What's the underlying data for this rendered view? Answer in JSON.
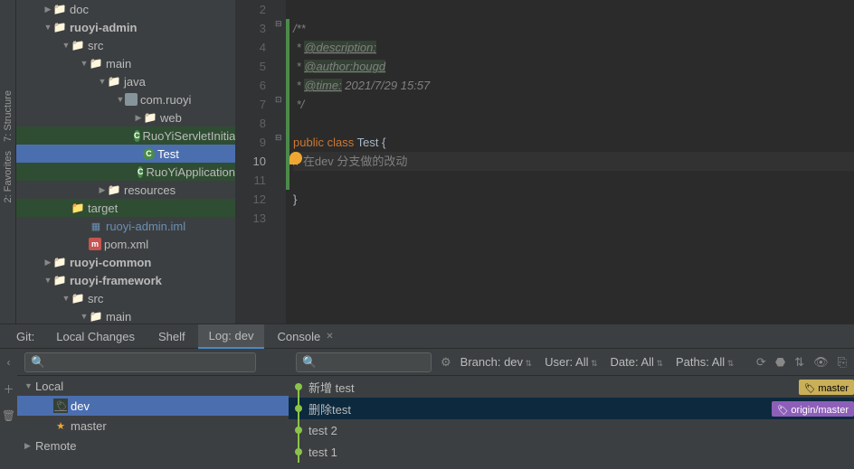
{
  "leftbar": {
    "structure": "7: Structure",
    "favorites": "2: Favorites"
  },
  "tree": [
    {
      "ind": 30,
      "arw": "closed",
      "ico": "folder",
      "txt": "doc"
    },
    {
      "ind": 30,
      "arw": "open",
      "ico": "folder",
      "txt": "ruoyi-admin",
      "bold": true
    },
    {
      "ind": 50,
      "arw": "open",
      "ico": "folder",
      "txt": "src"
    },
    {
      "ind": 70,
      "arw": "open",
      "ico": "folder",
      "txt": "main"
    },
    {
      "ind": 90,
      "arw": "open",
      "ico": "folder",
      "txt": "java"
    },
    {
      "ind": 110,
      "arw": "open",
      "ico": "pkg",
      "txt": "com.ruoyi"
    },
    {
      "ind": 130,
      "arw": "closed",
      "ico": "folder",
      "txt": "web"
    },
    {
      "ind": 130,
      "arw": "none",
      "ico": "cls",
      "txt": "RuoYiServletInitializer",
      "hl": true
    },
    {
      "ind": 130,
      "arw": "none",
      "ico": "cls",
      "txt": "Test",
      "sel": true,
      "hl": true
    },
    {
      "ind": 130,
      "arw": "none",
      "ico": "cls",
      "txt": "RuoYiApplication",
      "hl": true
    },
    {
      "ind": 90,
      "arw": "closed",
      "ico": "folder",
      "txt": "resources"
    },
    {
      "ind": 50,
      "arw": "none",
      "ico": "folder-o",
      "txt": "target",
      "hl": true
    },
    {
      "ind": 70,
      "arw": "none",
      "ico": "iml",
      "txt": "ruoyi-admin.iml",
      "color": "#6a8fb3"
    },
    {
      "ind": 70,
      "arw": "none",
      "ico": "pom",
      "txt": "pom.xml"
    },
    {
      "ind": 30,
      "arw": "closed",
      "ico": "folder",
      "txt": "ruoyi-common",
      "bold": true
    },
    {
      "ind": 30,
      "arw": "open",
      "ico": "folder",
      "txt": "ruoyi-framework",
      "bold": true
    },
    {
      "ind": 50,
      "arw": "open",
      "ico": "folder",
      "txt": "src"
    },
    {
      "ind": 70,
      "arw": "open",
      "ico": "folder",
      "txt": "main"
    }
  ],
  "editor": {
    "lines": [
      2,
      3,
      4,
      5,
      6,
      7,
      8,
      9,
      10,
      11,
      12,
      13
    ],
    "current": 10,
    "code": {
      "l3": "/**",
      "l4": " * ",
      "t4": "@description:",
      "l5": " * ",
      "t5": "@author:hougd",
      "l6": " * ",
      "t6": "@time:",
      "d6": " 2021/7/29 15:57",
      "l7": " */",
      "k9a": "public",
      "k9b": "class",
      "i9": "Test",
      "b9": "{",
      "c10": "// 在dev 分支做的改动",
      "b12": "}"
    }
  },
  "tabs": {
    "git": "Git:",
    "local": "Local Changes",
    "shelf": "Shelf",
    "log": "Log: dev",
    "console": "Console"
  },
  "branches": [
    {
      "ind": 8,
      "arw": "▼",
      "ico": "",
      "txt": "Local"
    },
    {
      "ind": 28,
      "arw": "",
      "ico": "tag",
      "txt": "dev",
      "sel": true
    },
    {
      "ind": 28,
      "arw": "",
      "ico": "star",
      "txt": "master"
    },
    {
      "ind": 8,
      "arw": "▶",
      "ico": "",
      "txt": "Remote"
    }
  ],
  "filters": {
    "branch": "Branch: dev",
    "user": "User: All",
    "date": "Date: All",
    "paths": "Paths: All"
  },
  "commits": [
    {
      "msg": "新增 test",
      "badge": "master",
      "bcls": "",
      "first": true
    },
    {
      "msg": "删除test",
      "badge": "origin/master",
      "bcls": "r",
      "sel": true
    },
    {
      "msg": "test 2"
    },
    {
      "msg": "test 1"
    }
  ]
}
